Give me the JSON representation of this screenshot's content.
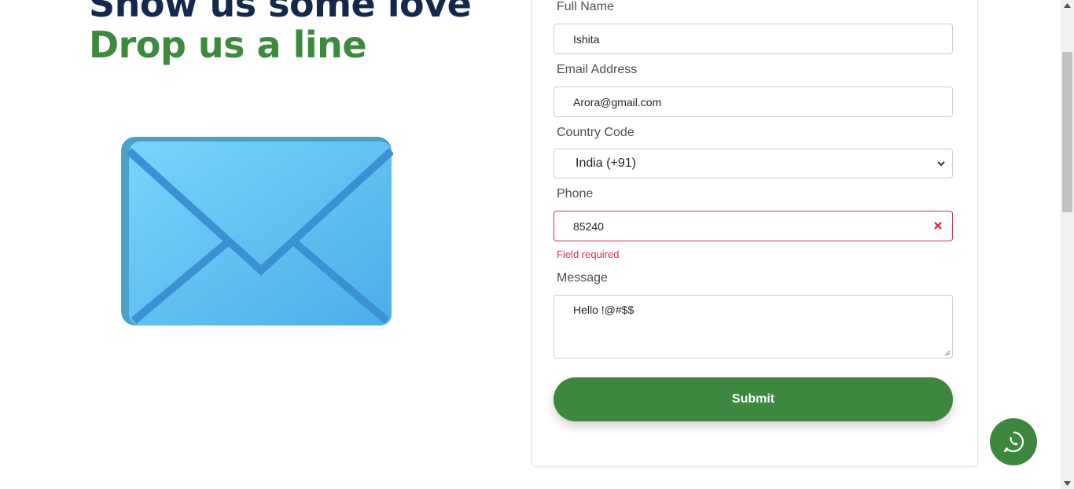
{
  "hero": {
    "heading_line1": "Show us some love",
    "heading_line2": "Drop us a line",
    "illustration": "envelope-icon"
  },
  "form": {
    "full_name": {
      "label": "Full Name",
      "value": "Ishita"
    },
    "email": {
      "label": "Email Address",
      "value": "Arora@gmail.com"
    },
    "country_code": {
      "label": "Country Code",
      "value": "India (+91)"
    },
    "phone": {
      "label": "Phone",
      "value": "85240",
      "error": "Field required"
    },
    "message": {
      "label": "Message",
      "value": "Hello !@#$$"
    },
    "submit_label": "Submit"
  },
  "floating": {
    "icon": "whatsapp-icon"
  },
  "colors": {
    "navy": "#14284b",
    "green": "#3d883e",
    "error": "#d63344"
  }
}
